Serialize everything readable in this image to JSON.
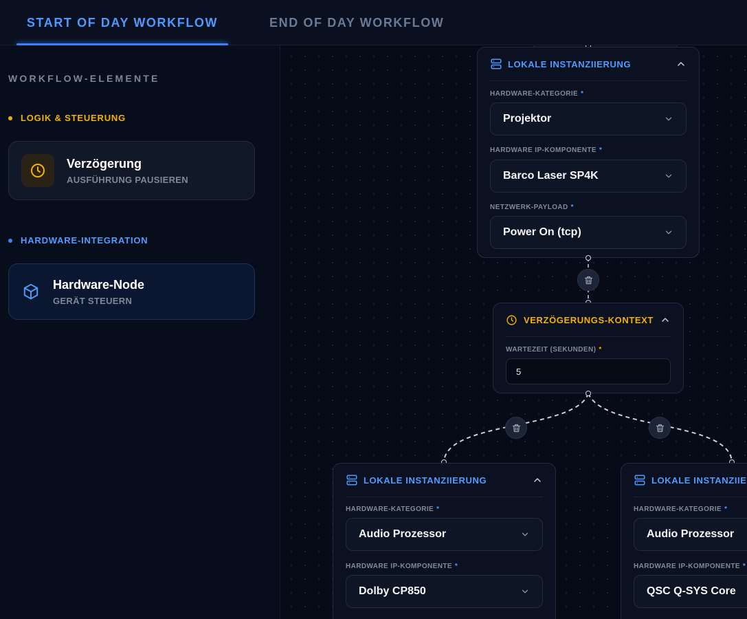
{
  "tabs": {
    "start": "START OF DAY WORKFLOW",
    "end": "END OF DAY WORKFLOW"
  },
  "sidebar": {
    "title": "WORKFLOW-ELEMENTE",
    "categories": [
      {
        "label": "LOGIK & STEUERUNG",
        "color": "#f5b100",
        "items": [
          {
            "title": "Verzögerung",
            "subtitle": "AUSFÜHRUNG PAUSIEREN",
            "icon": "clock-icon"
          }
        ]
      },
      {
        "label": "HARDWARE-INTEGRATION",
        "color": "#3b82f6",
        "items": [
          {
            "title": "Hardware-Node",
            "subtitle": "GERÄT STEUERN",
            "icon": "cube-icon"
          }
        ]
      }
    ]
  },
  "canvas": {
    "nodes": {
      "hw_top": {
        "title": "LOKALE INSTANZIIERUNG",
        "fields": [
          {
            "label": "HARDWARE-KATEGORIE",
            "required": "*",
            "value": "Projektor"
          },
          {
            "label": "HARDWARE IP-KOMPONENTE",
            "required": "*",
            "value": "Barco Laser SP4K"
          },
          {
            "label": "NETZWERK-PAYLOAD",
            "required": "*",
            "value": "Power On (tcp)"
          }
        ]
      },
      "delay": {
        "title": "VERZÖGERUNGS-KONTEXT",
        "field": {
          "label": "WARTEZEIT (SEKUNDEN)",
          "required": "*",
          "value": "5"
        }
      },
      "hw_left": {
        "title": "LOKALE INSTANZIIERUNG",
        "fields": [
          {
            "label": "HARDWARE-KATEGORIE",
            "required": "*",
            "value": "Audio Prozessor"
          },
          {
            "label": "HARDWARE IP-KOMPONENTE",
            "required": "*",
            "value": "Dolby CP850"
          }
        ]
      },
      "hw_right": {
        "title": "LOKALE INSTANZIIERUNG",
        "fields": [
          {
            "label": "HARDWARE-KATEGORIE",
            "required": "*",
            "value": "Audio Prozessor"
          },
          {
            "label": "HARDWARE IP-KOMPONENTE",
            "required": "*",
            "value": "QSC Q-SYS Core"
          }
        ]
      }
    }
  },
  "colors": {
    "accent_blue": "#3b82f6",
    "accent_amber": "#f5b100",
    "background": "#070b18"
  }
}
